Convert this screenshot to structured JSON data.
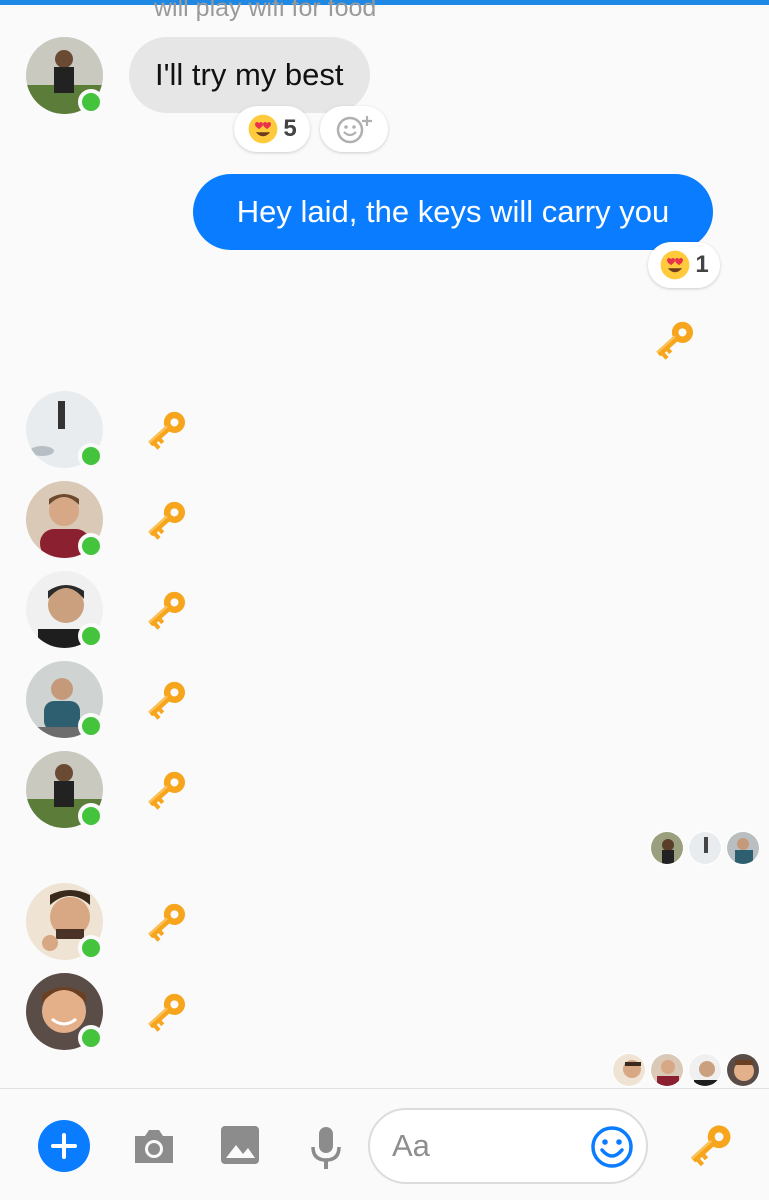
{
  "thread": {
    "previous_message_tail": "will play wifi for food",
    "messages": [
      {
        "sender": "other",
        "text": "I'll try my best",
        "reaction": {
          "emoji": "heart-eyes",
          "count": "5"
        }
      },
      {
        "sender": "me",
        "text": "Hey laid, the keys will carry you",
        "reaction": {
          "emoji": "heart-eyes",
          "count": "1"
        }
      }
    ]
  },
  "composer": {
    "placeholder": "Aa"
  },
  "colors": {
    "accent": "#0a7cff",
    "online": "#43c43c",
    "incoming_bubble": "#e6e6e6",
    "key": "#f5a623"
  }
}
